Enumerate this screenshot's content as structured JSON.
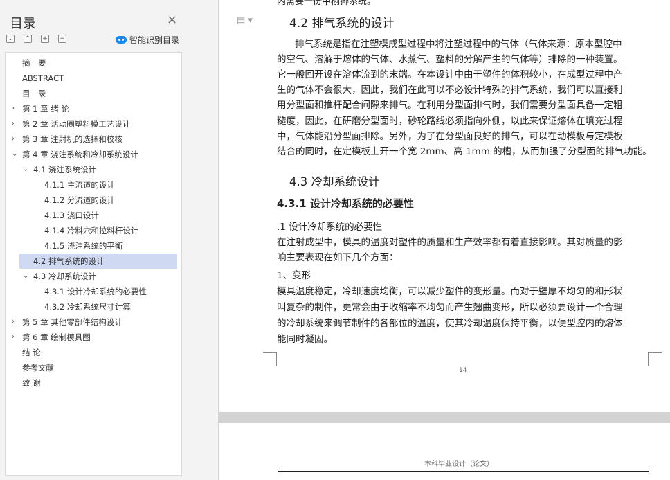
{
  "sidebar": {
    "title": "目录",
    "close_icon": "×",
    "controls": [
      "⌄",
      "⌃",
      "+",
      "−"
    ],
    "smart_label": "智能识别目录",
    "toc": [
      {
        "label": "摘　要",
        "level": 0,
        "arrow": "",
        "active": false
      },
      {
        "label": "ABSTRACT",
        "level": 0,
        "arrow": "",
        "active": false
      },
      {
        "label": "目　录",
        "level": 0,
        "arrow": "",
        "active": false
      },
      {
        "label": "第 1 章  绪  论",
        "level": 0,
        "arrow": "›",
        "active": false
      },
      {
        "label": "第 2 章  活动圈塑料模工艺设计",
        "level": 0,
        "arrow": "›",
        "active": false
      },
      {
        "label": "第 3 章  注射机的选择和校核",
        "level": 0,
        "arrow": "›",
        "active": false
      },
      {
        "label": "第 4 章  浇注系统和冷却系统设计",
        "level": 0,
        "arrow": "⌄",
        "active": false
      },
      {
        "label": "4.1 浇注系统设计",
        "level": 1,
        "arrow": "⌄",
        "active": false
      },
      {
        "label": "4.1.1 主流道的设计",
        "level": 2,
        "arrow": "",
        "active": false
      },
      {
        "label": "4.1.2 分流道的设计",
        "level": 2,
        "arrow": "",
        "active": false
      },
      {
        "label": "4.1.3 浇口设计",
        "level": 2,
        "arrow": "",
        "active": false
      },
      {
        "label": "4.1.4 冷料穴和拉料杆设计",
        "level": 2,
        "arrow": "",
        "active": false
      },
      {
        "label": "4.1.5 浇注系统的平衡",
        "level": 2,
        "arrow": "",
        "active": false
      },
      {
        "label": "4.2 排气系统的设计",
        "level": 1,
        "arrow": "",
        "active": true
      },
      {
        "label": "4.3 冷却系统设计",
        "level": 1,
        "arrow": "⌄",
        "active": false
      },
      {
        "label": "4.3.1 设计冷却系统的必要性",
        "level": 2,
        "arrow": "",
        "active": false
      },
      {
        "label": "4.3.2 冷却系统尺寸计算",
        "level": 2,
        "arrow": "",
        "active": false
      },
      {
        "label": " 第 5 章  其他零部件结构设计",
        "level": 0,
        "arrow": "›",
        "active": false
      },
      {
        "label": "第 6 章   绘制模具图",
        "level": 0,
        "arrow": "›",
        "active": false
      },
      {
        "label": "结  论",
        "level": 0,
        "arrow": "",
        "active": false
      },
      {
        "label": "参考文献",
        "level": 0,
        "arrow": "",
        "active": false
      },
      {
        "label": "致  谢",
        "level": 0,
        "arrow": "",
        "active": false
      }
    ]
  },
  "document": {
    "top_cut": "内需要一份中栩排系统。",
    "h_42": "4.2 排气系统的设计",
    "para1": [
      "排气系统是指在注塑模成型过程中将注塑过程中的气体（气体来源：原本型腔中",
      "的空气、溶解于熔体的气体、水蒸气、塑料的分解产生的气体等）排除的一种装置。",
      "它一般回开设在溶体流到的末端。在本设计中由于塑件的体积较小，在成型过程中产",
      "生的气体不会很大，因此，我们在此可以不必设计特殊的排气系统，我们可以直接利",
      "用分型面和推杆配合间隙来排气。在利用分型面排气时，我们需要分型面具备一定粗",
      "糙度，因此，在研磨分型面时，砂轮路线必须指向外侧，以此来保证熔体在填充过程",
      "中，气体能沿分型面排除。另外，为了在分型面良好的排气，可以在动模板与定模板",
      "结合的同时，在定模板上开一个宽 2mm、高 1mm 的槽，从而加强了分型面的排气功能。"
    ],
    "h_43": "4.3 冷却系统设计",
    "h_431": "4.3.1 设计冷却系统的必要性",
    "sub1": ".1 设计冷却系统的必要性",
    "para2": [
      "在注射成型中，模具的温度对塑件的质量和生产效率都有着直接影响。其对质量的影",
      "响主要表现在如下几个方面："
    ],
    "item1": "1、变形",
    "para3": [
      "模具温度稳定，冷却速度均衡，可以减少塑件的变形量。而对于壁厚不均匀的和形状",
      "叫复杂的制件，更常会由于收缩率不均匀而产生翘曲变形，所以必须要设计一个合理",
      "的冷却系统来调节制件的各部位的温度，使其冷却温度保持平衡，以便型腔内的熔体",
      "能同时凝固。"
    ],
    "page_number": "14",
    "page2_header": "本科毕业设计（论文）"
  }
}
